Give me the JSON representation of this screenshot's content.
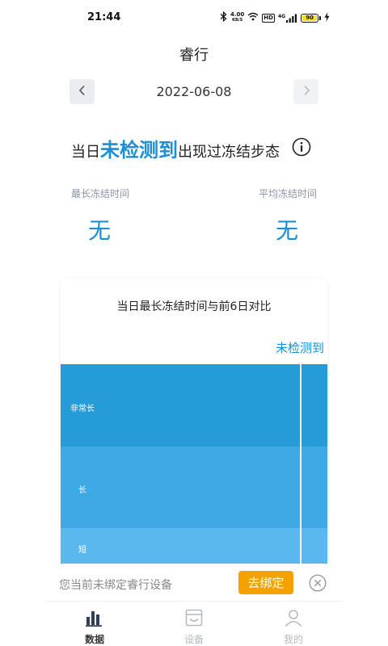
{
  "status_bar": {
    "time": "21:44",
    "network_speed_value": "4.00",
    "network_speed_unit": "KB/S",
    "hd_badge": "HD",
    "network_type": "4G",
    "battery": "90"
  },
  "header": {
    "title": "睿行"
  },
  "date_nav": {
    "date": "2022-06-08"
  },
  "summary": {
    "prefix": "当日",
    "emphasis": "未检测到",
    "suffix": "出现过冻结步态"
  },
  "stats": {
    "longest_label": "最长冻结时间",
    "longest_value": "无",
    "average_label": "平均冻结时间",
    "average_value": "无"
  },
  "chart_card": {
    "title": "当日最长冻结时间与前6日对比",
    "legend": "未检测到",
    "bands": [
      {
        "label": "非常长",
        "color": "#259bd8"
      },
      {
        "label": "长",
        "color": "#3fa9e6"
      },
      {
        "label": "短",
        "color": "#5bb8ee"
      }
    ]
  },
  "banner": {
    "text": "您当前未绑定睿行设备",
    "button": "去绑定"
  },
  "tabbar": {
    "tabs": [
      {
        "label": "数据"
      },
      {
        "label": "设备"
      },
      {
        "label": "我的"
      }
    ]
  },
  "colors": {
    "accent": "#1a8fd1",
    "bind_button": "#f5a100"
  }
}
